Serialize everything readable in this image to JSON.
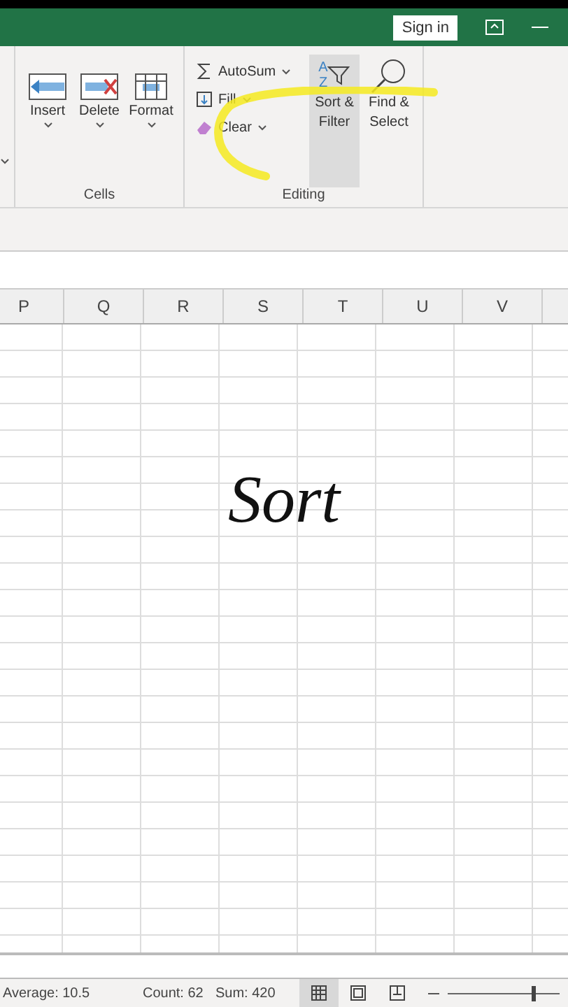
{
  "title_bar": {
    "sign_in": "Sign in"
  },
  "ribbon": {
    "groups": [
      {
        "label": "Cells",
        "buttons": [
          {
            "kind": "insert",
            "label": "Insert"
          },
          {
            "kind": "delete",
            "label": "Delete"
          },
          {
            "kind": "format",
            "label": "Format"
          }
        ]
      },
      {
        "label": "Editing",
        "small_buttons": [
          {
            "kind": "sum",
            "label": "AutoSum"
          },
          {
            "kind": "fill",
            "label": "Fill"
          },
          {
            "kind": "clear",
            "label": "Clear"
          }
        ],
        "buttons": [
          {
            "kind": "sort",
            "label": "Sort & Filter",
            "selected": true,
            "icon_letters": [
              "A",
              "Z"
            ]
          },
          {
            "kind": "find",
            "label": "Find & Select",
            "selected": false
          }
        ]
      }
    ]
  },
  "columns": [
    "P",
    "Q",
    "R",
    "S",
    "T",
    "U",
    "V"
  ],
  "overlay_caption": "Sort",
  "status_bar": {
    "average": "Average: 10.5",
    "count": "Count: 62",
    "sum": "Sum: 420",
    "views": [
      {
        "kind": "normal",
        "selected": true
      },
      {
        "kind": "layout",
        "selected": false
      },
      {
        "kind": "break",
        "selected": false
      }
    ],
    "zoom": {
      "level": 0.75
    }
  }
}
